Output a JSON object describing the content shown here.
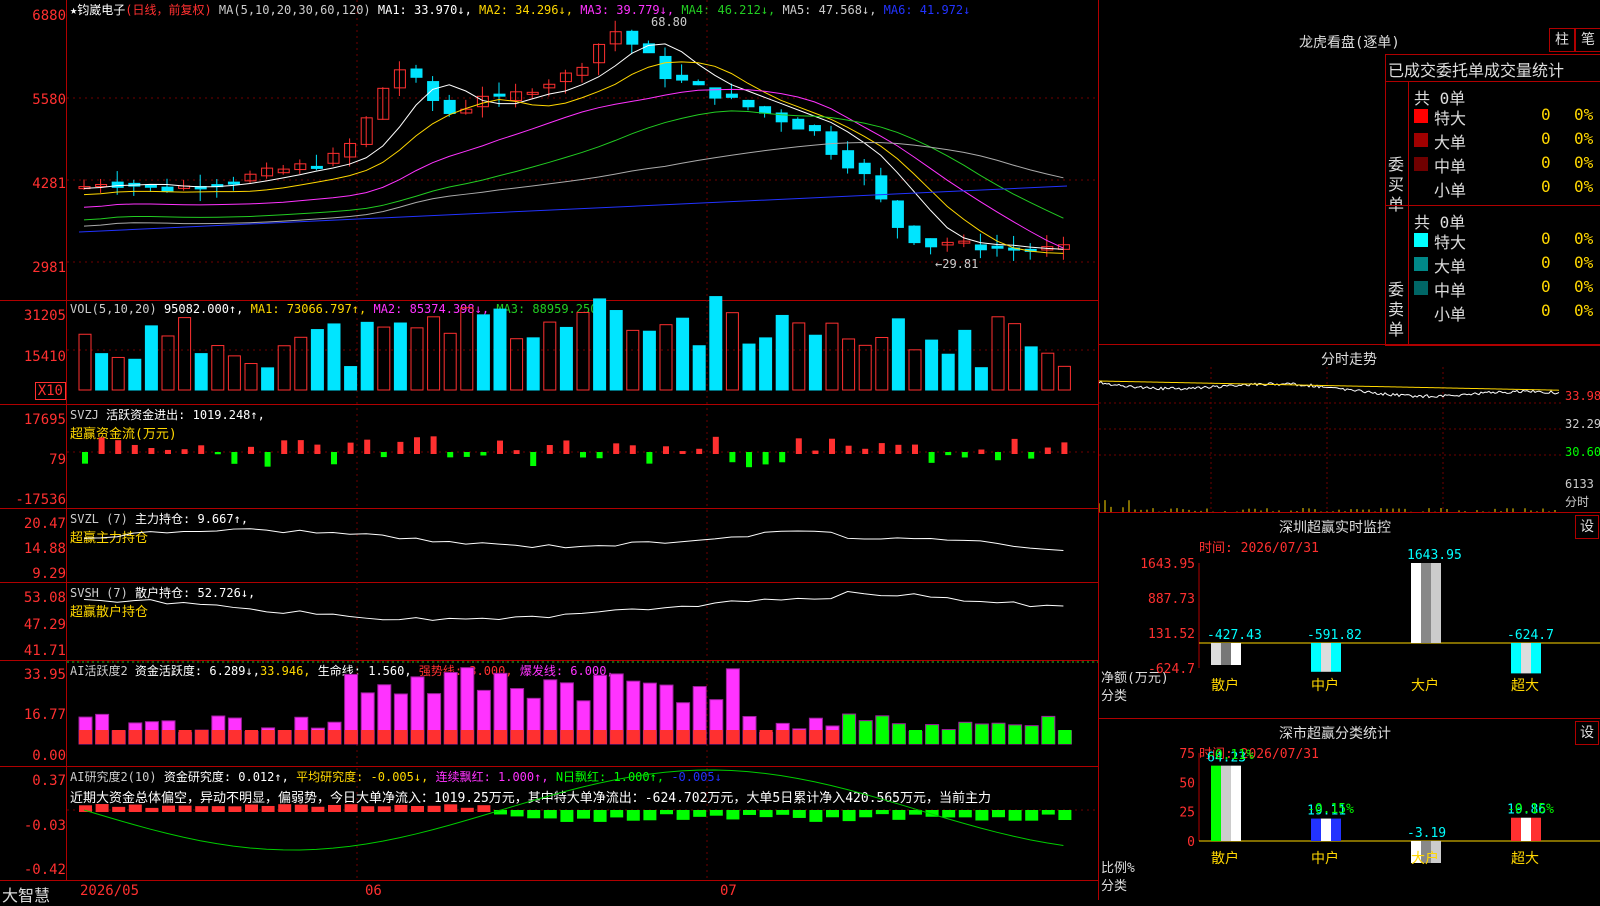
{
  "colors": {
    "up": "#ff3030",
    "down": "#00e5ff",
    "ma1": "#ffffff",
    "ma2": "#ffd700",
    "ma3": "#ff33ff",
    "ma4": "#22cc22",
    "ma5": "#aaaaaa",
    "ma6": "#2233ff",
    "grid": "#b00000",
    "magenta": "#ff33ff",
    "green": "#00ff00"
  },
  "kline": {
    "title": "★钧崴电子",
    "mode": "(日线，前复权)",
    "ma_params": "MA(5,10,20,30,60,120)",
    "ma1": "MA1: 33.970↓,",
    "ma2": "MA2: 34.296↓,",
    "ma3": "MA3: 39.779↓,",
    "ma4": "MA4: 46.212↓,",
    "ma5": "MA5: 47.568↓,",
    "ma6": "MA6: 41.972↓",
    "yticks": [
      "6880",
      "5580",
      "4281",
      "2981"
    ],
    "high_label": "68.80",
    "low_label": "←29.81",
    "ylim": [
      2981,
      6880
    ]
  },
  "vol": {
    "header": "VOL(5,10,20)",
    "value": "95082.000↑,",
    "ma1": "MA1: 73066.797↑,",
    "ma2": "MA2: 85374.398↓,",
    "ma3": "MA3: 88959.250↓",
    "yticks": [
      "31205",
      "15410"
    ],
    "unit": "X10"
  },
  "svzj": {
    "header": "SVZJ",
    "name": "活跃资金进出: 1019.248↑,",
    "sub": "超赢资金流(万元)",
    "yticks": [
      "17695",
      "79",
      "-17536"
    ]
  },
  "svzl": {
    "header": "SVZL (7)",
    "name": "主力持仓: 9.667↑,",
    "sub": "超赢主力持仓",
    "yticks": [
      "20.47",
      "14.88",
      "9.29"
    ]
  },
  "svsh": {
    "header": "SVSH (7)",
    "name": "散户持仓: 52.726↓,",
    "sub": "超赢散户持仓",
    "yticks": [
      "53.08",
      "47.29",
      "41.71"
    ]
  },
  "ai1": {
    "header": "AI活跃度2",
    "a": "资金活跃度: 6.289↓,",
    "b": "33.946,",
    "c": "生命线: 1.560,",
    "d": "强势线: 3.000,",
    "e": "爆发线: 6.000,",
    "yticks": [
      "33.95",
      "16.77",
      "0.00"
    ]
  },
  "ai2": {
    "header": "AI研究度2(10)",
    "a": "资金研究度: 0.012↑,",
    "b": "平均研究度: -0.005↓,",
    "c": "连续飘红: 1.000↑,",
    "d": "N日飘红: 1.000↑,",
    "e": "-0.005↓",
    "text": "近期大资金总体偏空，异动不明显，偏弱势，今日大单净流入：1019.25万元，其中特大单净流出：-624.702万元，大单5日累计净入420.565万元，当前主力",
    "yticks": [
      "0.37",
      "-0.03",
      "-0.42"
    ]
  },
  "bottom": {
    "brand": "大智慧",
    "dates": [
      "2026/05",
      "06",
      "07"
    ]
  },
  "lhb": {
    "title": "龙虎看盘(逐单)",
    "btn1": "柱",
    "btn2": "笔",
    "tabs": "已成交委托单成交量统计",
    "buy": {
      "side": "委买单",
      "total": "共 0单",
      "rows": [
        {
          "label": "特大",
          "v": "0",
          "p": "0%",
          "c": "#ff0000"
        },
        {
          "label": "大单",
          "v": "0",
          "p": "0%",
          "c": "#a00000"
        },
        {
          "label": "中单",
          "v": "0",
          "p": "0%",
          "c": "#700000"
        },
        {
          "label": "小单",
          "v": "0",
          "p": "0%",
          "c": ""
        }
      ]
    },
    "sell": {
      "side": "委卖单",
      "total": "共 0单",
      "rows": [
        {
          "label": "特大",
          "v": "0",
          "p": "0%",
          "c": "#00ffff"
        },
        {
          "label": "大单",
          "v": "0",
          "p": "0%",
          "c": "#008888"
        },
        {
          "label": "中单",
          "v": "0",
          "p": "0%",
          "c": "#006666"
        },
        {
          "label": "小单",
          "v": "0",
          "p": "0%",
          "c": ""
        }
      ]
    }
  },
  "fs": {
    "title": "分时走势",
    "yticks": [
      "33.98",
      "32.29",
      "30.60"
    ],
    "vol": "6133",
    "vol_label": "分时"
  },
  "mon": {
    "title": "深圳超赢实时监控",
    "btn": "设",
    "time": "时间: 2026/07/31",
    "yticks": [
      "1643.95",
      "887.73",
      "131.52",
      "-624.7"
    ],
    "ylabel": "净额(万元)",
    "xlabel": "分类",
    "cats": [
      "散户",
      "中户",
      "大户",
      "超大"
    ],
    "values": [
      -427.43,
      -591.82,
      1643.95,
      -624.7
    ],
    "vlabels": [
      "-427.43",
      "-591.82",
      "1643.95",
      "-624.7"
    ]
  },
  "cls": {
    "title": "深市超赢分类统计",
    "btn": "设",
    "time": "时间: 2026/07/31",
    "yticks": [
      "75",
      "50",
      "25",
      "0"
    ],
    "ylabel": "比例%",
    "xlabel": "分类",
    "cats": [
      "散户",
      "中户",
      "大户",
      "超大"
    ],
    "values": [
      64.23,
      19.11,
      -3.19,
      19.86
    ],
    "vlabels": [
      "64.23",
      "19.11",
      "-3.19",
      "19.86"
    ],
    "toplabels": [
      "-0.11%",
      "-0.15%",
      "",
      "-0.15%"
    ]
  }
}
